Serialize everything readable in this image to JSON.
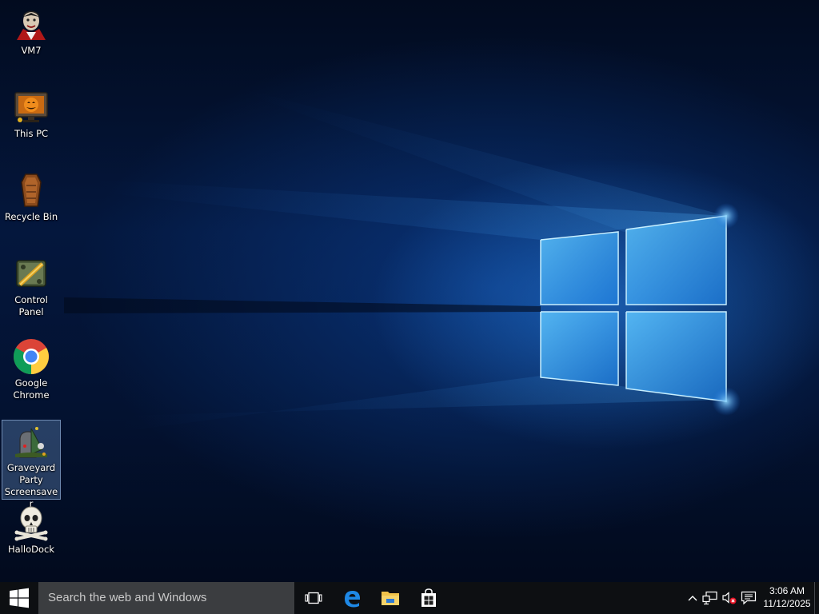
{
  "desktop": {
    "icons": [
      {
        "label": "VM7",
        "icon": "vampire-icon"
      },
      {
        "label": "This PC",
        "icon": "pumpkin-monitor-icon"
      },
      {
        "label": "Recycle Bin",
        "icon": "coffin-bin-icon"
      },
      {
        "label": "Control Panel",
        "icon": "spooky-control-panel-icon"
      },
      {
        "label": "Google Chrome",
        "icon": "chrome-icon"
      },
      {
        "label": "Graveyard Party Screensaver",
        "icon": "graveyard-party-icon",
        "selected": true
      },
      {
        "label": "HalloDock",
        "icon": "skull-crossbones-icon"
      }
    ],
    "wallpaper": "windows-10-hero-blue",
    "colors": {
      "accent": "#1f8fff",
      "background": "#04173d"
    }
  },
  "taskbar": {
    "search_placeholder": "Search the web and Windows",
    "pinned": [
      {
        "name": "task-view",
        "icon": "task-view-icon"
      },
      {
        "name": "edge",
        "icon": "edge-icon"
      },
      {
        "name": "file-explorer",
        "icon": "folder-icon"
      },
      {
        "name": "store",
        "icon": "store-icon"
      }
    ],
    "tray": {
      "icons": [
        "chevron-up-icon",
        "network-icon",
        "volume-muted-icon",
        "action-center-icon"
      ],
      "time": "3:06 AM",
      "date": "11/12/2025"
    }
  }
}
